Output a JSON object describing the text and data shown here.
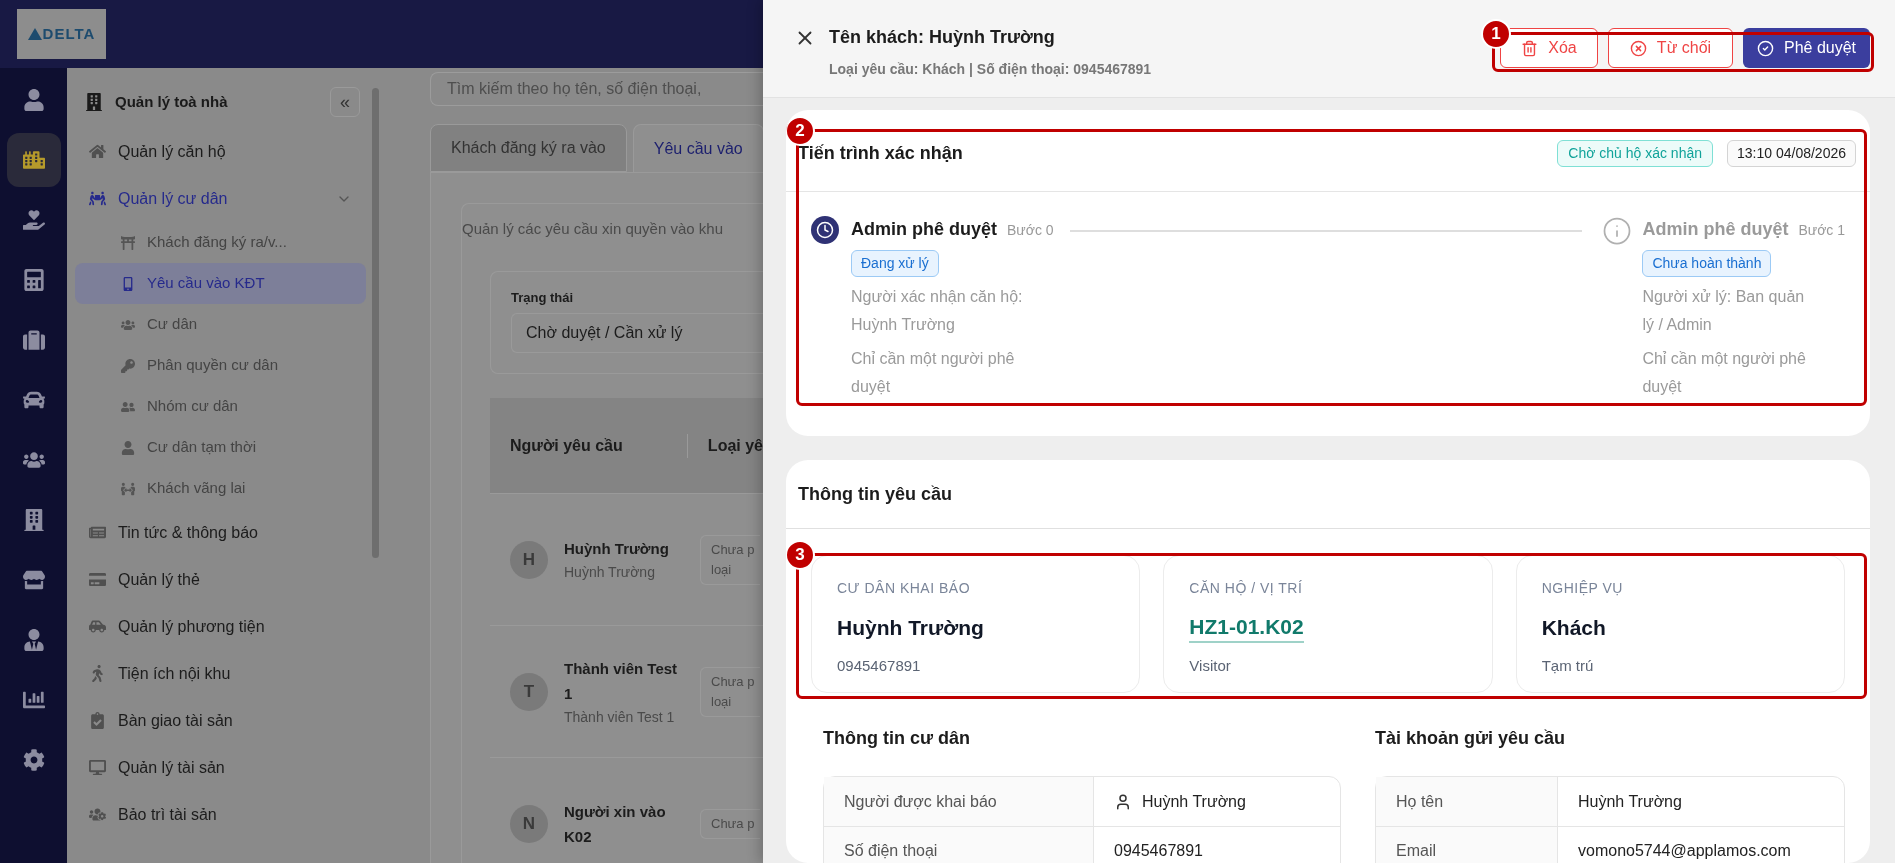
{
  "logo": {
    "text": "DELTA"
  },
  "rail": [
    {
      "selected": false
    },
    {
      "selected": true
    },
    {
      "selected": false
    },
    {
      "selected": false
    },
    {
      "selected": false
    },
    {
      "selected": false
    },
    {
      "selected": false
    },
    {
      "selected": false
    },
    {
      "selected": false
    },
    {
      "selected": false
    },
    {
      "selected": false
    },
    {
      "selected": false
    }
  ],
  "sidebar": {
    "title": "Quản lý toà nhà",
    "collapse_label": "«",
    "items": [
      {
        "label": "Quản lý căn hộ",
        "selected": false
      },
      {
        "label": "Quản lý cư dân",
        "selected": true,
        "expanded": true,
        "children": [
          {
            "label": "Khách đăng ký ra/v...",
            "selected": false
          },
          {
            "label": "Yêu cầu vào KĐT",
            "selected": true
          },
          {
            "label": "Cư dân",
            "selected": false
          },
          {
            "label": "Phân quyền cư dân",
            "selected": false
          },
          {
            "label": "Nhóm cư dân",
            "selected": false
          },
          {
            "label": "Cư dân tạm thời",
            "selected": false
          },
          {
            "label": "Khách vãng lai",
            "selected": false
          }
        ]
      },
      {
        "label": "Tin tức & thông báo",
        "selected": false
      },
      {
        "label": "Quản lý thẻ",
        "selected": false
      },
      {
        "label": "Quản lý phương tiện",
        "selected": false
      },
      {
        "label": "Tiện ích nội khu",
        "selected": false
      },
      {
        "label": "Bàn giao tài sản",
        "selected": false
      },
      {
        "label": "Quản lý tài sản",
        "selected": false
      },
      {
        "label": "Bảo trì tài sản",
        "selected": false
      }
    ]
  },
  "main": {
    "search": {
      "placeholder": "Tìm kiếm theo họ tên, số điện thoại,"
    },
    "tabs": [
      {
        "label": "Khách đăng ký ra vào",
        "selected": false
      },
      {
        "label": "Yêu cầu vào",
        "selected": true
      }
    ],
    "description": "Quản lý các yêu cầu xin quyền vào khu",
    "filter": {
      "label": "Trạng thái",
      "value": "Chờ duyệt / Cần xử lý"
    },
    "table": {
      "columns": [
        "Người yêu cầu",
        "Loại yê"
      ],
      "rows": [
        {
          "initial": "H",
          "name": "Huỳnh Trường",
          "sub": "Huỳnh Trường",
          "type": [
            "Chưa p",
            "loại"
          ]
        },
        {
          "initial": "T",
          "name": "Thành viên Test 1",
          "sub": "Thành viên Test 1",
          "type": [
            "Chưa p",
            "loại"
          ]
        },
        {
          "initial": "N",
          "name": "Người xin vào K02",
          "sub": "",
          "type": [
            "Chưa p"
          ]
        }
      ]
    }
  },
  "drawer": {
    "title": "Tên khách: Huỳnh Trường",
    "subtitle": "Loại yêu cầu: Khách | Số điện thoại: 0945467891",
    "actions": [
      {
        "label": "Xóa",
        "kind": "delete"
      },
      {
        "label": "Từ chối",
        "kind": "reject"
      },
      {
        "label": "Phê duyệt",
        "kind": "approve"
      }
    ],
    "progress": {
      "title": "Tiến trình xác nhận",
      "status": "Chờ chủ hộ xác nhận",
      "time": "13:10 04/08/2026",
      "steps": [
        {
          "title": "Admin phê duyệt",
          "step": "Bước 0",
          "current": true,
          "badge": "Đang xử lý",
          "lines": [
            "Người xác nhận căn hộ: Huỳnh Trường",
            "Chỉ cần một người phê duyệt"
          ]
        },
        {
          "title": "Admin phê duyệt",
          "step": "Bước 1",
          "current": false,
          "badge": "Chưa hoàn thành",
          "lines": [
            "Người xử lý: Ban quản lý / Admin",
            "Chỉ cần một người phê duyệt"
          ]
        }
      ]
    },
    "request": {
      "title": "Thông tin yêu cầu",
      "summary": [
        {
          "label": "CƯ DÂN KHAI BÁO",
          "value": "Huỳnh Trường",
          "sub": "0945467891",
          "kind": "text"
        },
        {
          "label": "CĂN HỘ / VỊ TRÍ",
          "value": "HZ1-01.K02",
          "sub": "Visitor",
          "kind": "link"
        },
        {
          "label": "NGHIỆP VỤ",
          "value": "Khách",
          "sub": "Tạm trú",
          "kind": "text"
        }
      ],
      "resident": {
        "title": "Thông tin cư dân",
        "rows": [
          {
            "label": "Người được khai báo",
            "value": "Huỳnh Trường"
          },
          {
            "label": "Số điện thoại",
            "value": "0945467891"
          }
        ]
      },
      "account": {
        "title": "Tài khoản gửi yêu cầu",
        "rows": [
          {
            "label": "Họ tên",
            "value": "Huỳnh Trường"
          },
          {
            "label": "Email",
            "value": "vomono5744@applamos.com"
          }
        ]
      }
    }
  },
  "annotations": [
    {
      "label": "1"
    },
    {
      "label": "2"
    },
    {
      "label": "3"
    }
  ]
}
